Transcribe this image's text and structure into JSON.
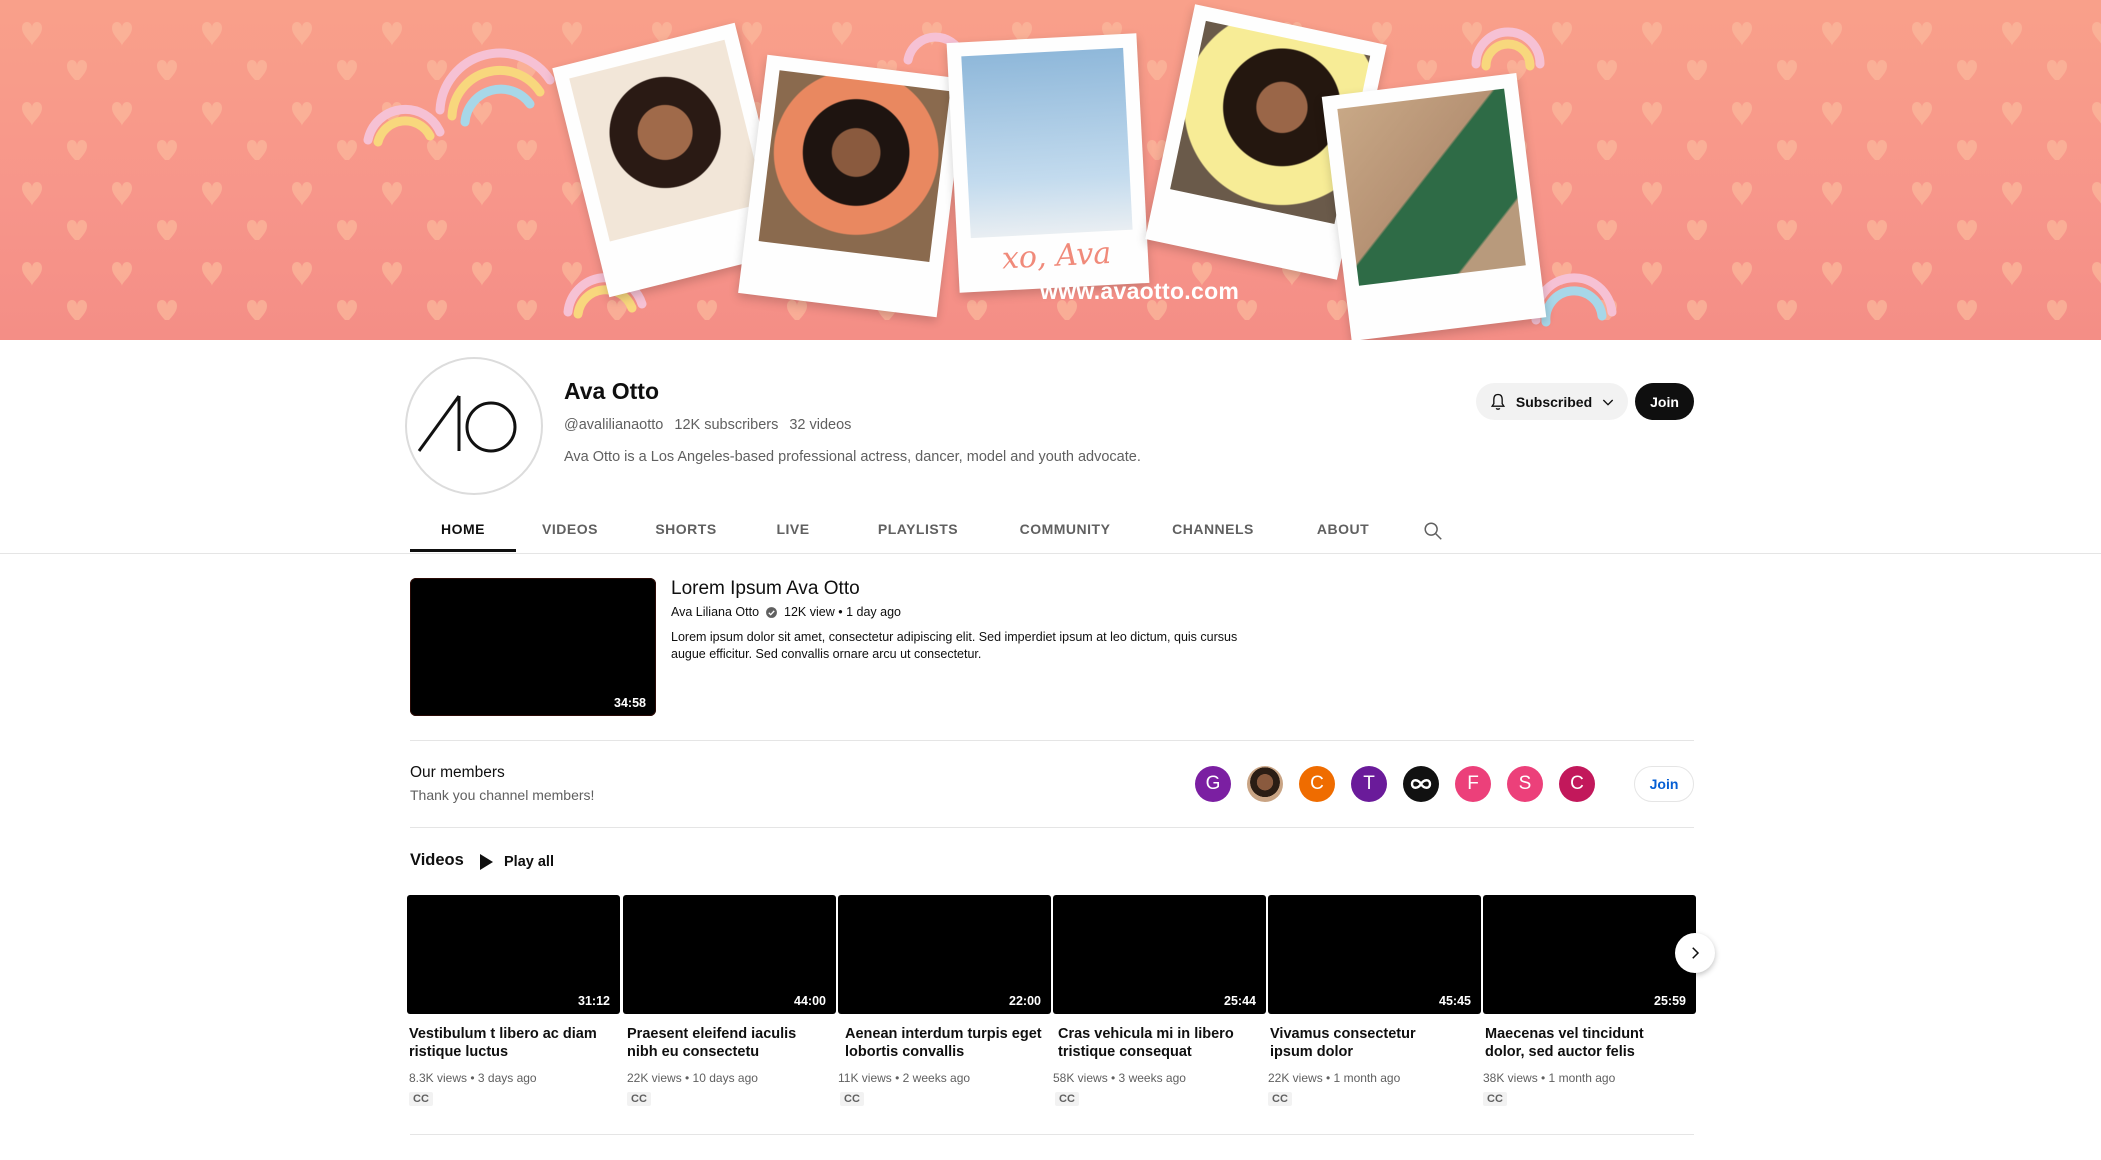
{
  "banner": {
    "url_text": "www.avaotto.com",
    "signature_text": "xo, Ava",
    "background_color": "#f79a8a"
  },
  "channel": {
    "name": "Ava Otto",
    "handle": "@avalilianaotto",
    "subscribers": "12K subscribers",
    "video_count": "32 videos",
    "description": "Ava Otto is a Los Angeles-based professional actress, dancer, model and youth advocate.",
    "subscribed_label": "Subscribed",
    "join_label": "Join"
  },
  "tabs": [
    {
      "label": "HOME",
      "active": true
    },
    {
      "label": "VIDEOS",
      "active": false
    },
    {
      "label": "SHORTS",
      "active": false
    },
    {
      "label": "LIVE",
      "active": false
    },
    {
      "label": "PLAYLISTS",
      "active": false
    },
    {
      "label": "COMMUNITY",
      "active": false
    },
    {
      "label": "CHANNELS",
      "active": false
    },
    {
      "label": "ABOUT",
      "active": false
    }
  ],
  "featured": {
    "title": "Lorem Ipsum Ava Otto",
    "channel": "Ava Liliana Otto",
    "views_age": "12K view • 1 day ago",
    "description": "Lorem ipsum dolor sit amet, consectetur adipiscing elit. Sed imperdiet ipsum at leo dictum, quis cursus augue efficitur. Sed convallis ornare arcu ut consectetur.",
    "duration": "34:58"
  },
  "members": {
    "title": "Our members",
    "subtitle": "Thank you channel members!",
    "join_label": "Join",
    "avatars": [
      {
        "letter": "G",
        "color": "#7b1fa2"
      },
      {
        "letter": "",
        "color": "#b58a6a"
      },
      {
        "letter": "C",
        "color": "#ef6c00"
      },
      {
        "letter": "T",
        "color": "#6a1b9a"
      },
      {
        "letter": "",
        "color": "#111111"
      },
      {
        "letter": "F",
        "color": "#ec407a"
      },
      {
        "letter": "S",
        "color": "#ec407a"
      },
      {
        "letter": "C",
        "color": "#c2185b"
      }
    ]
  },
  "videos_shelf": {
    "title": "Videos",
    "play_all_label": "Play all",
    "items": [
      {
        "title": "Vestibulum t libero ac diam ristique luctus",
        "stats": "8.3K views • 3 days ago",
        "duration": "31:12",
        "cc": "CC"
      },
      {
        "title": "Praesent eleifend iaculis nibh eu consectetu",
        "stats": "22K views • 10 days ago",
        "duration": "44:00",
        "cc": "CC"
      },
      {
        "title": "Aenean interdum turpis eget lobortis convallis",
        "stats": "11K views • 2 weeks ago",
        "duration": "22:00",
        "cc": "CC"
      },
      {
        "title": "Cras vehicula mi in libero tristique consequat",
        "stats": "58K views • 3 weeks ago",
        "duration": "25:44",
        "cc": "CC"
      },
      {
        "title": "Vivamus consectetur ipsum dolor",
        "stats": "22K views • 1 month ago",
        "duration": "45:45",
        "cc": "CC"
      },
      {
        "title": "Maecenas vel tincidunt dolor, sed auctor felis",
        "stats": "38K views • 1 month ago",
        "duration": "25:59",
        "cc": "CC"
      }
    ]
  }
}
